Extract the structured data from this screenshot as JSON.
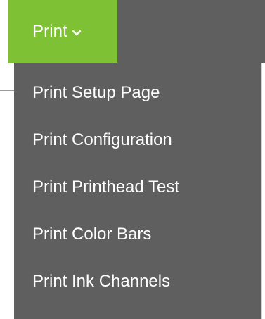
{
  "header": {
    "print_menu_label": "Print"
  },
  "dropdown": {
    "items": [
      {
        "label": "Print Setup Page"
      },
      {
        "label": "Print Configuration"
      },
      {
        "label": "Print Printhead Test"
      },
      {
        "label": "Print Color Bars"
      },
      {
        "label": "Print Ink Channels"
      }
    ]
  },
  "colors": {
    "accent_green": "#7ec135",
    "menu_background": "#5f5f5f",
    "text_white": "#ffffff"
  },
  "icons": {
    "print_menu_chevron": "chevron-down-icon"
  }
}
